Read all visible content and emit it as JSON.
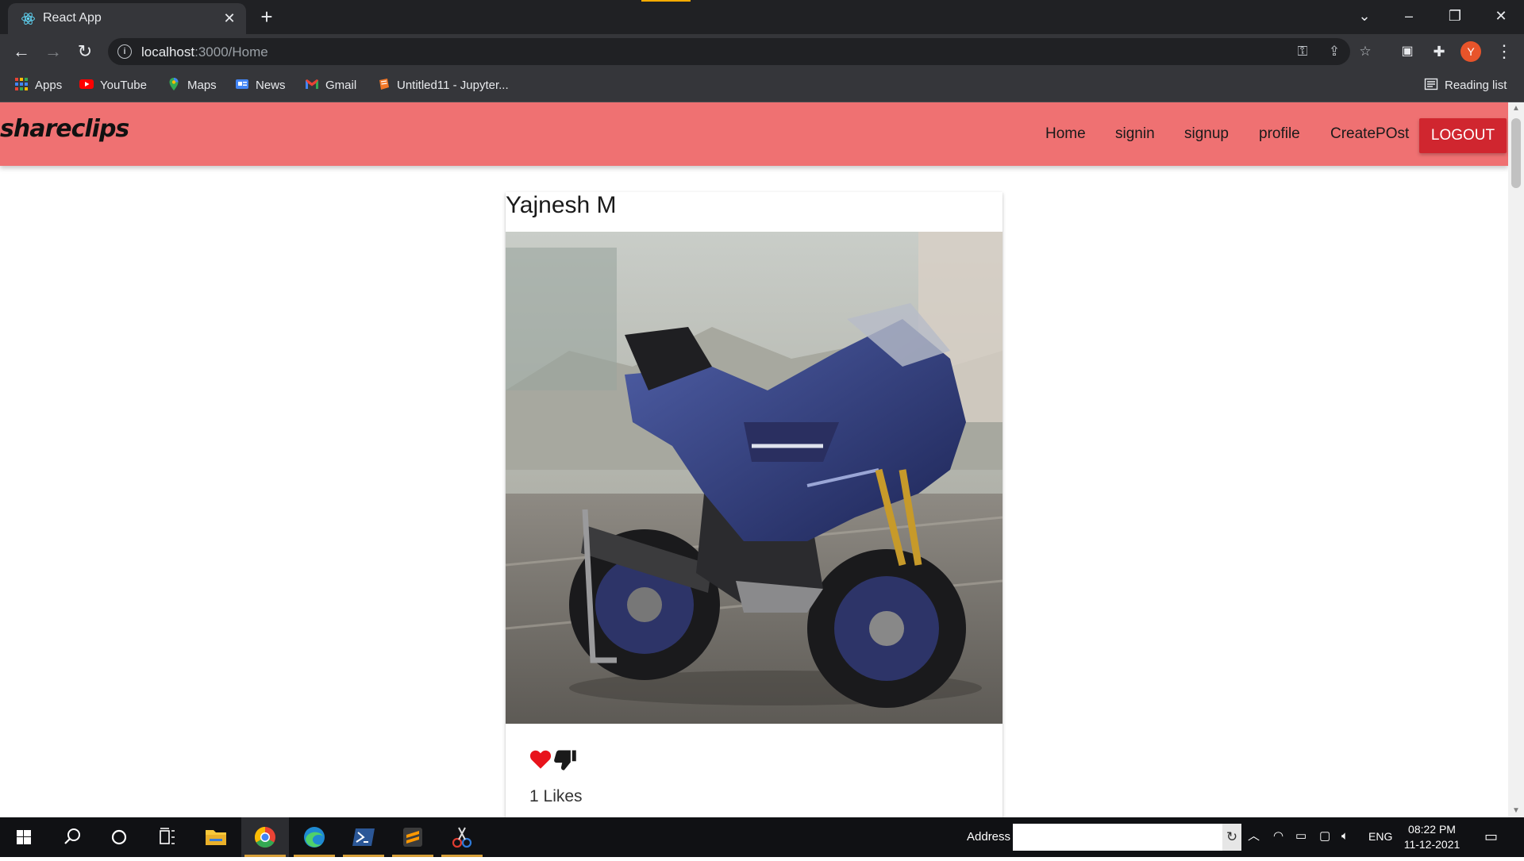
{
  "browser": {
    "tab_title": "React App",
    "tab_close": "✕",
    "new_tab": "+",
    "url_host": "localhost",
    "url_path": ":3000/Home",
    "window_controls": {
      "chevron": "⌄",
      "minimize": "–",
      "restore": "❐",
      "close": "✕"
    },
    "bookmarks": [
      {
        "label": "Apps",
        "icon": "apps-grid-icon"
      },
      {
        "label": "YouTube",
        "icon": "youtube-icon"
      },
      {
        "label": "Maps",
        "icon": "maps-icon"
      },
      {
        "label": "News",
        "icon": "news-icon"
      },
      {
        "label": "Gmail",
        "icon": "gmail-icon"
      },
      {
        "label": "Untitled11 - Jupyter...",
        "icon": "jupyter-icon"
      }
    ],
    "reading_list": "Reading list",
    "profile_initial": "Y"
  },
  "app": {
    "brand": "shareclips",
    "nav": [
      "Home",
      "signin",
      "signup",
      "profile",
      "CreatePOst"
    ],
    "logout": "LOGOUT",
    "navbar_color": "#ef7172",
    "logout_color": "#d0262f"
  },
  "post": {
    "author": "Yajnesh M",
    "image_alt": "blue sport motorcycle",
    "likes_text": "1 Likes"
  },
  "taskbar": {
    "address_label": "Address",
    "language": "ENG",
    "time": "08:22 PM",
    "date": "11-12-2021"
  }
}
